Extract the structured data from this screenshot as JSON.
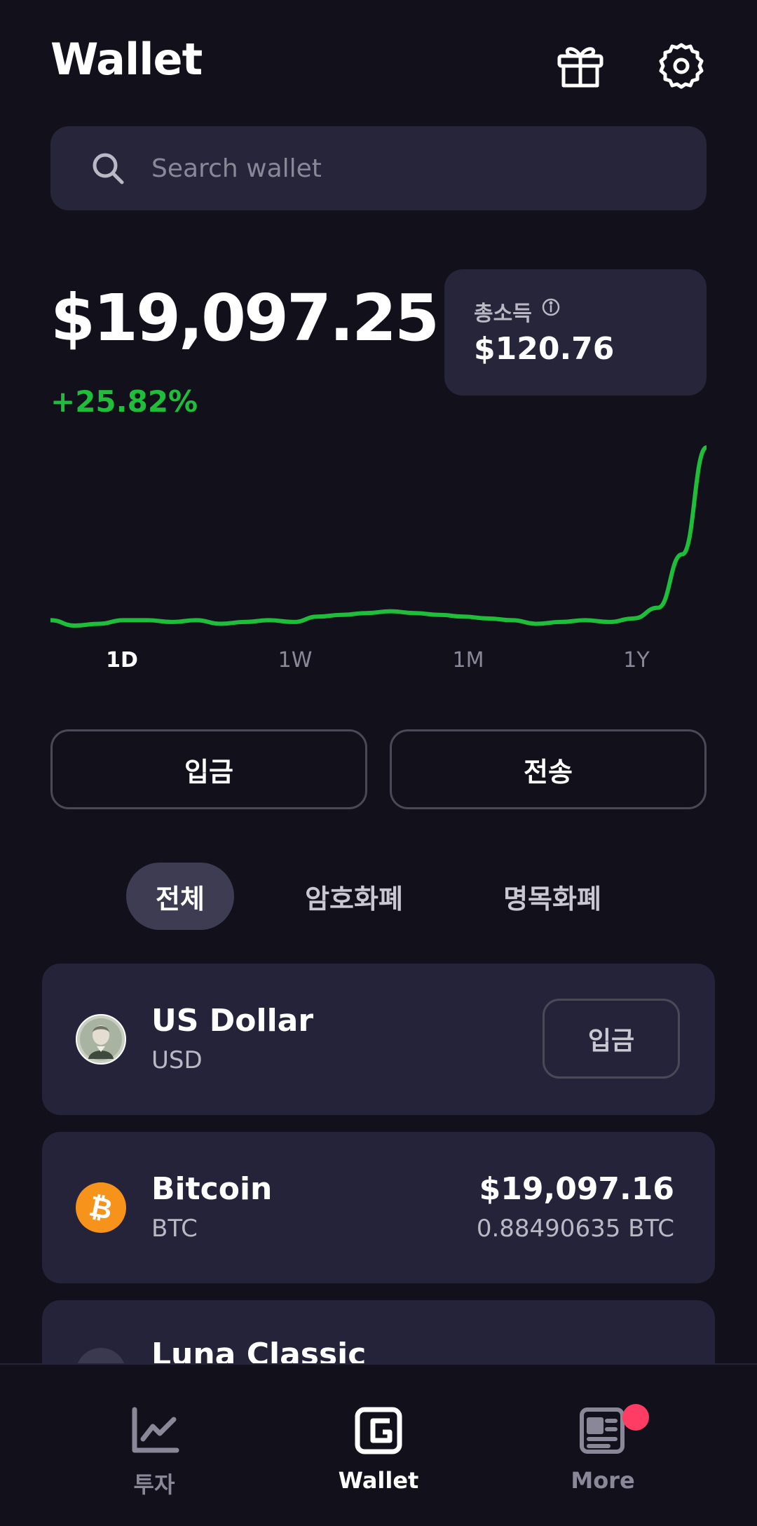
{
  "header": {
    "title": "Wallet",
    "gift_icon": "gift-icon",
    "settings_icon": "gear-icon"
  },
  "search": {
    "placeholder": "Search wallet",
    "value": ""
  },
  "portfolio": {
    "balance": "$19,097.25",
    "change": "+25.82%",
    "change_color": "#1fbe3a",
    "income_label": "총소득",
    "income_value": "$120.76"
  },
  "chart_data": {
    "type": "line",
    "series_color": "#1fbe3a",
    "values": [
      3,
      0,
      1,
      3,
      3,
      2,
      3,
      1,
      2,
      3,
      2,
      5,
      6,
      7,
      8,
      7,
      6,
      5,
      4,
      3,
      1,
      2,
      3,
      2,
      4,
      10,
      40,
      100
    ],
    "grid": false
  },
  "periods": [
    {
      "label": "1D",
      "active": true
    },
    {
      "label": "1W",
      "active": false
    },
    {
      "label": "1M",
      "active": false
    },
    {
      "label": "1Y",
      "active": false
    }
  ],
  "actions": {
    "deposit": "입금",
    "send": "전송"
  },
  "tabs": [
    {
      "label": "전체",
      "active": true
    },
    {
      "label": "암호화폐",
      "active": false
    },
    {
      "label": "명목화폐",
      "active": false
    }
  ],
  "assets": [
    {
      "name": "US Dollar",
      "symbol": "USD",
      "action": "입금",
      "icon": "us-dollar-icon"
    },
    {
      "name": "Bitcoin",
      "symbol": "BTC",
      "value": "$19,097.16",
      "quantity": "0.88490635 BTC",
      "icon": "bitcoin-icon",
      "icon_color": "#f7931a"
    },
    {
      "name": "Luna Classic",
      "icon": "luna-classic-icon"
    }
  ],
  "nav": [
    {
      "label": "투자",
      "icon": "chart-line-icon",
      "active": false
    },
    {
      "label": "Wallet",
      "icon": "wallet-icon",
      "active": true
    },
    {
      "label": "More",
      "icon": "news-icon",
      "active": false,
      "badge": true
    }
  ]
}
